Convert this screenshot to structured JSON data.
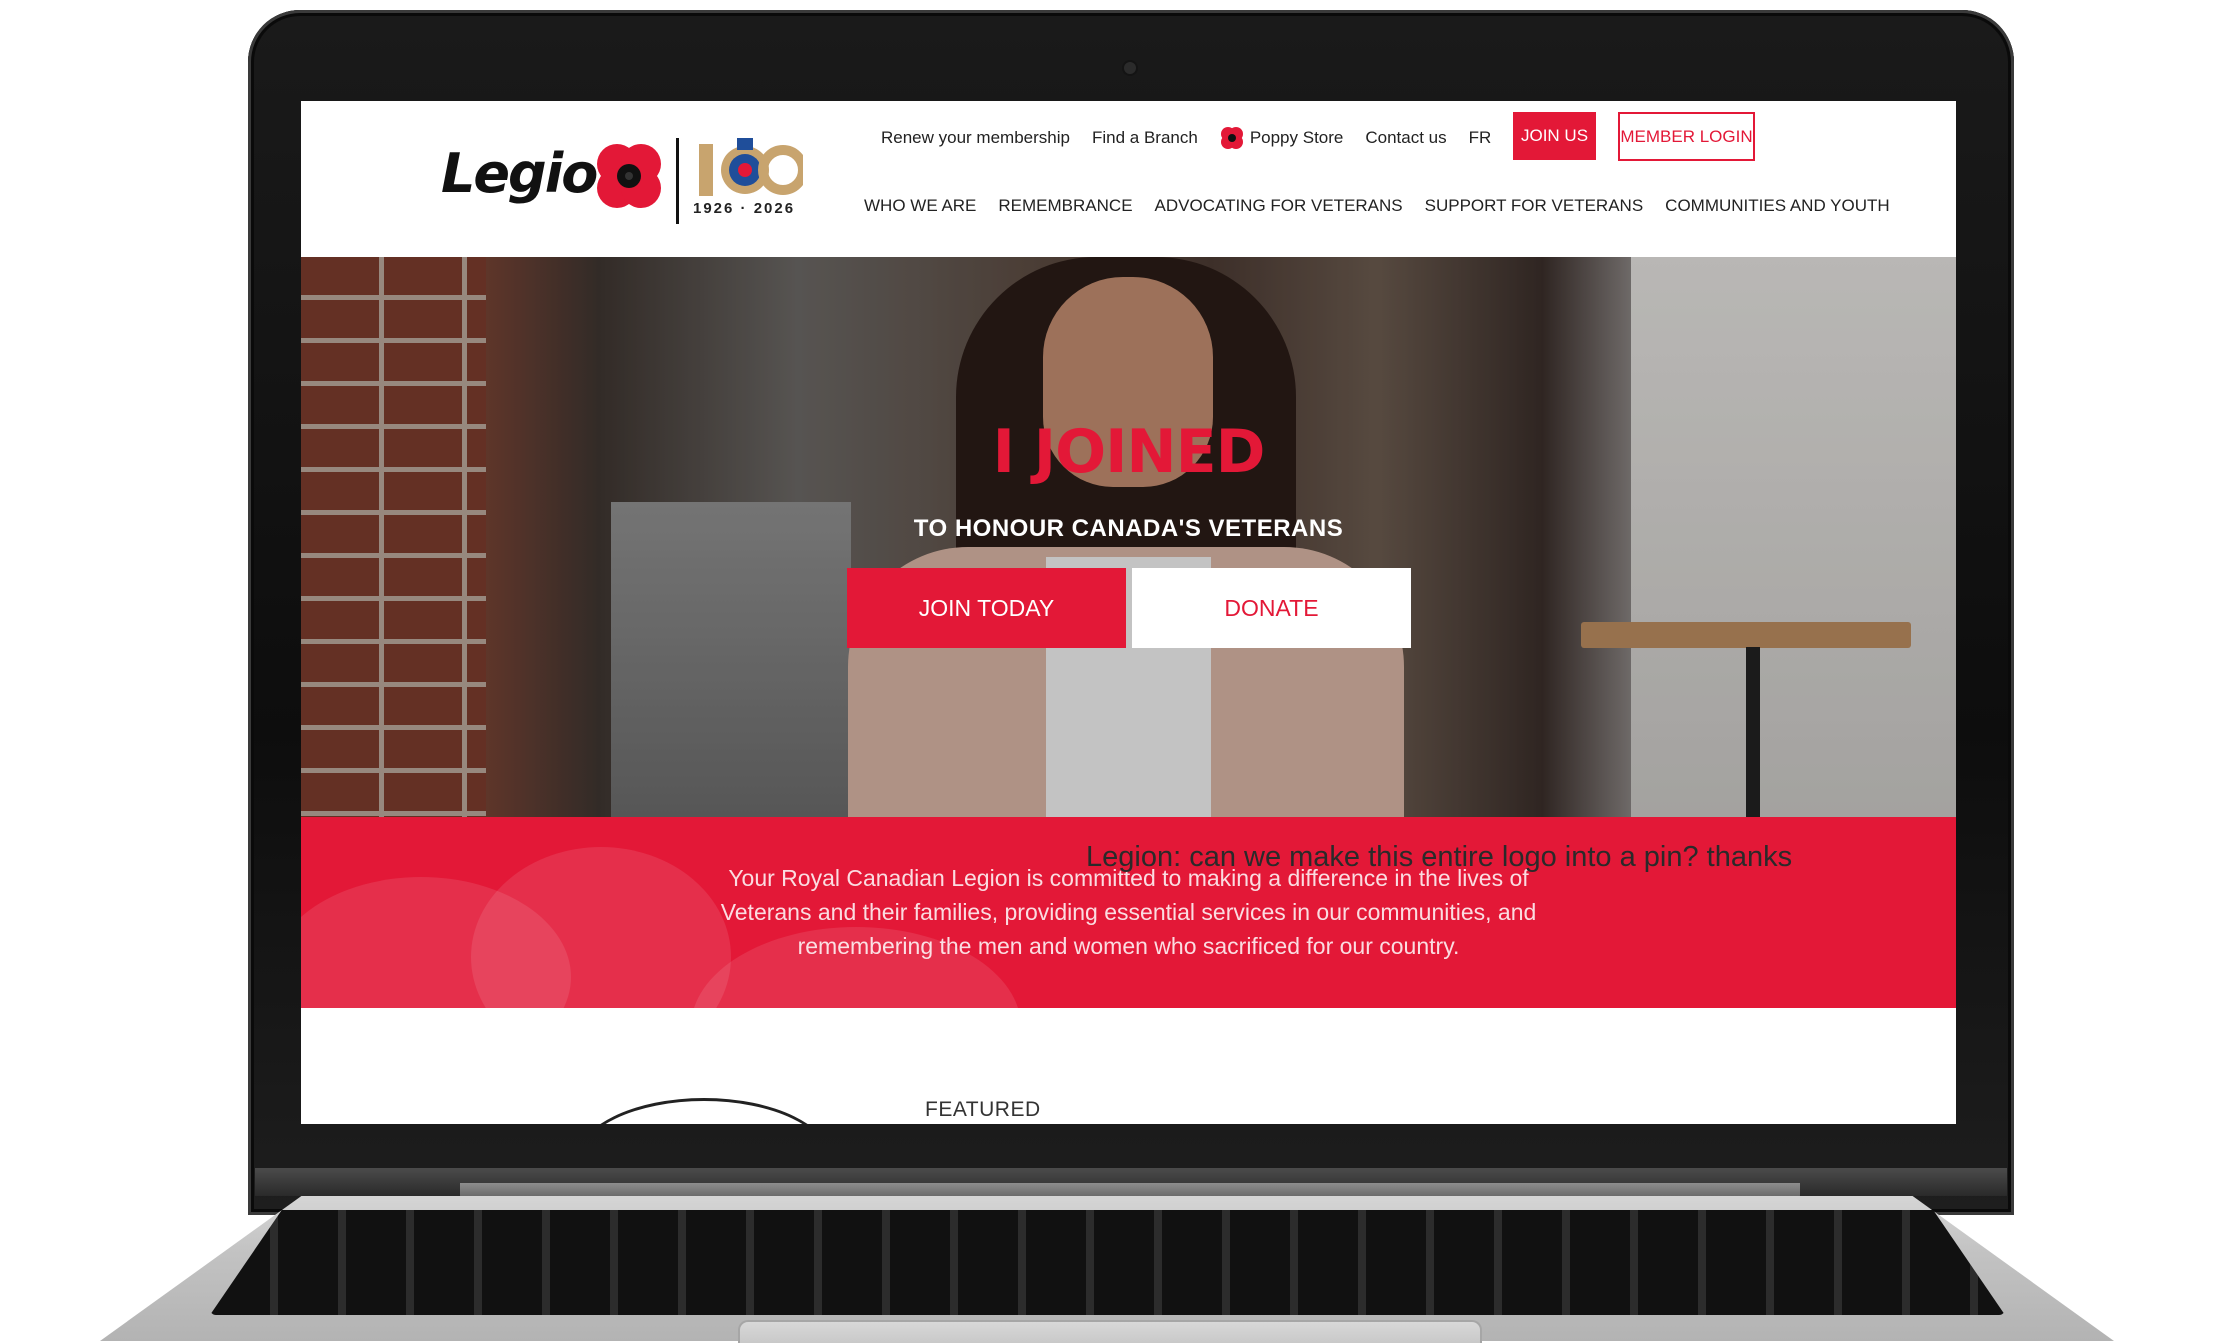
{
  "brand": {
    "logo_text": "Legion",
    "anniversary": "100",
    "years": "1926 · 2026",
    "accent_color": "#e31837"
  },
  "top_links": [
    {
      "label": "Renew your membership",
      "icon": ""
    },
    {
      "label": "Find a Branch",
      "icon": ""
    },
    {
      "label": "Poppy Store",
      "icon": "poppy-icon"
    },
    {
      "label": "Contact us",
      "icon": ""
    },
    {
      "label": "FR",
      "icon": ""
    }
  ],
  "header_buttons": {
    "join_us": "JOIN US",
    "member_login": "MEMBER LOGIN"
  },
  "main_nav": [
    "WHO WE ARE",
    "REMEMBRANCE",
    "ADVOCATING FOR VETERANS",
    "SUPPORT FOR VETERANS",
    "COMMUNITIES AND YOUTH"
  ],
  "hero": {
    "title": "I JOINED",
    "subtitle": "TO HONOUR CANADA'S VETERANS",
    "join_button": "JOIN TODAY",
    "donate_button": "DONATE"
  },
  "mission": {
    "text": "Your Royal Canadian Legion is committed to making a difference in the lives of Veterans and their families, providing essential services in our communities, and remembering the men and women who sacrificed for our country."
  },
  "annotation": "Legion: can we make this entire logo into a pin? thanks",
  "featured": {
    "label": "FEATURED"
  }
}
